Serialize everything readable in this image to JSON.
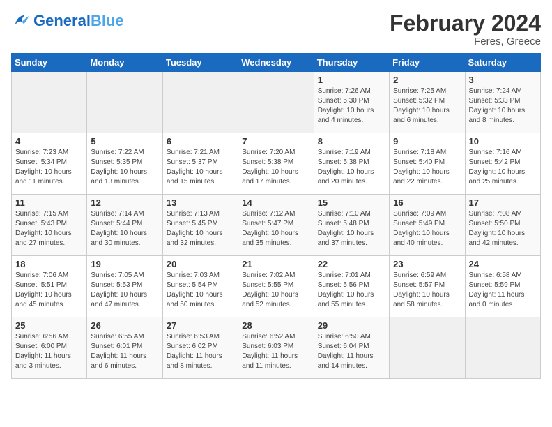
{
  "header": {
    "logo_general": "General",
    "logo_blue": "Blue",
    "title": "February 2024",
    "subtitle": "Feres, Greece"
  },
  "weekdays": [
    "Sunday",
    "Monday",
    "Tuesday",
    "Wednesday",
    "Thursday",
    "Friday",
    "Saturday"
  ],
  "weeks": [
    [
      {
        "day": "",
        "info": ""
      },
      {
        "day": "",
        "info": ""
      },
      {
        "day": "",
        "info": ""
      },
      {
        "day": "",
        "info": ""
      },
      {
        "day": "1",
        "info": "Sunrise: 7:26 AM\nSunset: 5:30 PM\nDaylight: 10 hours\nand 4 minutes."
      },
      {
        "day": "2",
        "info": "Sunrise: 7:25 AM\nSunset: 5:32 PM\nDaylight: 10 hours\nand 6 minutes."
      },
      {
        "day": "3",
        "info": "Sunrise: 7:24 AM\nSunset: 5:33 PM\nDaylight: 10 hours\nand 8 minutes."
      }
    ],
    [
      {
        "day": "4",
        "info": "Sunrise: 7:23 AM\nSunset: 5:34 PM\nDaylight: 10 hours\nand 11 minutes."
      },
      {
        "day": "5",
        "info": "Sunrise: 7:22 AM\nSunset: 5:35 PM\nDaylight: 10 hours\nand 13 minutes."
      },
      {
        "day": "6",
        "info": "Sunrise: 7:21 AM\nSunset: 5:37 PM\nDaylight: 10 hours\nand 15 minutes."
      },
      {
        "day": "7",
        "info": "Sunrise: 7:20 AM\nSunset: 5:38 PM\nDaylight: 10 hours\nand 17 minutes."
      },
      {
        "day": "8",
        "info": "Sunrise: 7:19 AM\nSunset: 5:38 PM\nDaylight: 10 hours\nand 20 minutes."
      },
      {
        "day": "9",
        "info": "Sunrise: 7:18 AM\nSunset: 5:40 PM\nDaylight: 10 hours\nand 22 minutes."
      },
      {
        "day": "10",
        "info": "Sunrise: 7:16 AM\nSunset: 5:42 PM\nDaylight: 10 hours\nand 25 minutes."
      }
    ],
    [
      {
        "day": "11",
        "info": "Sunrise: 7:15 AM\nSunset: 5:43 PM\nDaylight: 10 hours\nand 27 minutes."
      },
      {
        "day": "12",
        "info": "Sunrise: 7:14 AM\nSunset: 5:44 PM\nDaylight: 10 hours\nand 30 minutes."
      },
      {
        "day": "13",
        "info": "Sunrise: 7:13 AM\nSunset: 5:45 PM\nDaylight: 10 hours\nand 32 minutes."
      },
      {
        "day": "14",
        "info": "Sunrise: 7:12 AM\nSunset: 5:47 PM\nDaylight: 10 hours\nand 35 minutes."
      },
      {
        "day": "15",
        "info": "Sunrise: 7:10 AM\nSunset: 5:48 PM\nDaylight: 10 hours\nand 37 minutes."
      },
      {
        "day": "16",
        "info": "Sunrise: 7:09 AM\nSunset: 5:49 PM\nDaylight: 10 hours\nand 40 minutes."
      },
      {
        "day": "17",
        "info": "Sunrise: 7:08 AM\nSunset: 5:50 PM\nDaylight: 10 hours\nand 42 minutes."
      }
    ],
    [
      {
        "day": "18",
        "info": "Sunrise: 7:06 AM\nSunset: 5:51 PM\nDaylight: 10 hours\nand 45 minutes."
      },
      {
        "day": "19",
        "info": "Sunrise: 7:05 AM\nSunset: 5:53 PM\nDaylight: 10 hours\nand 47 minutes."
      },
      {
        "day": "20",
        "info": "Sunrise: 7:03 AM\nSunset: 5:54 PM\nDaylight: 10 hours\nand 50 minutes."
      },
      {
        "day": "21",
        "info": "Sunrise: 7:02 AM\nSunset: 5:55 PM\nDaylight: 10 hours\nand 52 minutes."
      },
      {
        "day": "22",
        "info": "Sunrise: 7:01 AM\nSunset: 5:56 PM\nDaylight: 10 hours\nand 55 minutes."
      },
      {
        "day": "23",
        "info": "Sunrise: 6:59 AM\nSunset: 5:57 PM\nDaylight: 10 hours\nand 58 minutes."
      },
      {
        "day": "24",
        "info": "Sunrise: 6:58 AM\nSunset: 5:59 PM\nDaylight: 11 hours\nand 0 minutes."
      }
    ],
    [
      {
        "day": "25",
        "info": "Sunrise: 6:56 AM\nSunset: 6:00 PM\nDaylight: 11 hours\nand 3 minutes."
      },
      {
        "day": "26",
        "info": "Sunrise: 6:55 AM\nSunset: 6:01 PM\nDaylight: 11 hours\nand 6 minutes."
      },
      {
        "day": "27",
        "info": "Sunrise: 6:53 AM\nSunset: 6:02 PM\nDaylight: 11 hours\nand 8 minutes."
      },
      {
        "day": "28",
        "info": "Sunrise: 6:52 AM\nSunset: 6:03 PM\nDaylight: 11 hours\nand 11 minutes."
      },
      {
        "day": "29",
        "info": "Sunrise: 6:50 AM\nSunset: 6:04 PM\nDaylight: 11 hours\nand 14 minutes."
      },
      {
        "day": "",
        "info": ""
      },
      {
        "day": "",
        "info": ""
      }
    ]
  ]
}
